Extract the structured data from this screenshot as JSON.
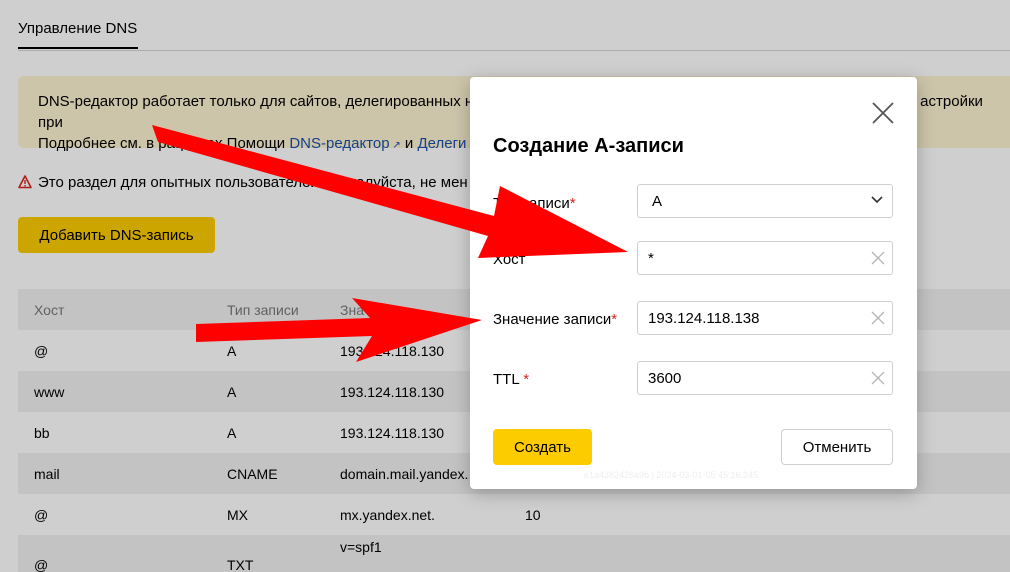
{
  "page": {
    "tab_title": "Управление DNS",
    "notice_line1": "DNS-редактор работает только для сайтов, делегированных н",
    "notice_line1_end": "астройки при",
    "notice_line2_prefix": "Подробнее см. в разделах Помощи ",
    "notice_link1": "DNS-редактор",
    "notice_and": " и ",
    "notice_link2": "Делеги",
    "warning_text": "Это раздел для опытных пользователей. Пожалуйста, не мен",
    "add_button": "Добавить DNS-запись"
  },
  "table": {
    "headers": [
      "Хост",
      "Тип записи",
      "Значение записи"
    ],
    "header_visible": {
      "host": "Хост",
      "type": "Тип записи",
      "value": "Зна"
    },
    "rows": [
      {
        "host": "@",
        "type": "A",
        "value": "193.124.118.130",
        "extra": ""
      },
      {
        "host": "www",
        "type": "A",
        "value": "193.124.118.130",
        "extra": ""
      },
      {
        "host": "bb",
        "type": "A",
        "value": "193.124.118.130",
        "extra": ""
      },
      {
        "host": "mail",
        "type": "CNAME",
        "value": "domain.mail.yandex.",
        "extra": ""
      },
      {
        "host": "@",
        "type": "MX",
        "value": "mx.yandex.net.",
        "extra": "10"
      },
      {
        "host": "@",
        "type": "TXT",
        "value": "v=spf1",
        "extra": ""
      }
    ]
  },
  "modal": {
    "title": "Создание A-записи",
    "close_icon": "close-icon",
    "fields": {
      "type": {
        "label": "Тип записи",
        "required": "*",
        "value": "A"
      },
      "host": {
        "label": "Хост",
        "value": "*"
      },
      "value": {
        "label": "Значение записи",
        "required": "*",
        "value": "193.124.118.138"
      },
      "ttl": {
        "label": "TTL",
        "required": "*",
        "value": "3600"
      }
    },
    "create_button": "Создать",
    "cancel_button": "Отменить",
    "stamp": "e1a4382426a9b | 2024-03-01-05:45:16.245"
  },
  "colors": {
    "accent_yellow": "#fdcc00",
    "link_blue": "#1a4fae",
    "required_red": "#d9261c",
    "arrow_red": "#ff0000"
  }
}
